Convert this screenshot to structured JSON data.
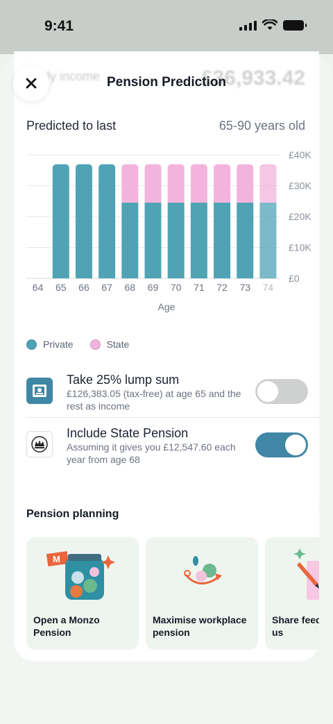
{
  "status": {
    "time": "9:41"
  },
  "background": {
    "label": "rly income",
    "amount": "£36,933.42"
  },
  "header": {
    "title": "Pension Prediction",
    "close_icon": "close-icon"
  },
  "prediction": {
    "label": "Predicted to last",
    "range": "65-90 years old"
  },
  "colors": {
    "private": "#4fa3b5",
    "state": "#f2b4dc",
    "toggle_on": "#3f87a5",
    "toggle_off": "#cfd1d0"
  },
  "chart_data": {
    "type": "bar",
    "stacked": true,
    "categories": [
      "64",
      "65",
      "66",
      "67",
      "68",
      "69",
      "70",
      "71",
      "72",
      "73",
      "74"
    ],
    "series": [
      {
        "name": "Private",
        "values": [
          0,
          36933,
          36933,
          36933,
          24500,
          24500,
          24500,
          24500,
          24500,
          24500,
          24500
        ]
      },
      {
        "name": "State",
        "values": [
          0,
          0,
          0,
          0,
          12433,
          12433,
          12433,
          12433,
          12433,
          12433,
          12433
        ]
      }
    ],
    "xlabel": "Age",
    "ylabel": "",
    "ylim": [
      0,
      40000
    ],
    "yticks": [
      "£0",
      "£10K",
      "£20K",
      "£30K",
      "£40K"
    ],
    "grid": true,
    "legend": "bottom-left"
  },
  "legend": {
    "private": "Private",
    "state": "State"
  },
  "options": [
    {
      "title": "Take 25% lump sum",
      "subtitle": "£126,383.05 (tax-free) at age 65 and the rest as income",
      "enabled": false,
      "icon": "money-icon"
    },
    {
      "title": "Include State Pension",
      "subtitle": "Assuming it gives you £12,547.60 each year from age 68",
      "enabled": true,
      "icon": "crown-icon"
    }
  ],
  "planning": {
    "title": "Pension planning",
    "cards": [
      {
        "label": "Open a Monzo Pension",
        "icon": "jar-icon"
      },
      {
        "label": "Maximise workplace pension",
        "icon": "coins-icon"
      },
      {
        "label": "Share feedback with us",
        "icon": "pencil-icon"
      }
    ]
  }
}
